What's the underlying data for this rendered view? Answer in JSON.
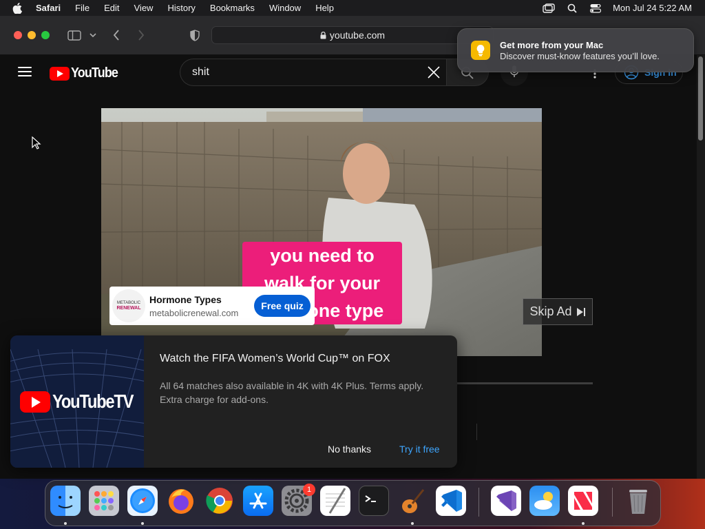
{
  "menubar": {
    "app": "Safari",
    "items": [
      "File",
      "Edit",
      "View",
      "History",
      "Bookmarks",
      "Window",
      "Help"
    ],
    "clock": "Mon Jul 24  5:22 AM"
  },
  "browser": {
    "url": "youtube.com"
  },
  "notification": {
    "title": "Get more from your Mac",
    "body": "Discover must-know features you’ll love."
  },
  "youtube": {
    "logo_text": "YouTube",
    "search_value": "shit",
    "signin_label": "Sign in"
  },
  "video": {
    "caption_lines": [
      "you need to",
      "walk for your",
      "hormone type"
    ],
    "ad": {
      "logo_line1": "METABOLIC",
      "logo_line2": "RENEWAL",
      "title": "Hormone Types",
      "url": "metabolicrenewal.com",
      "cta": "Free quiz"
    },
    "skip_label": "Skip Ad"
  },
  "promo": {
    "logo_text": "YouTubeTV",
    "title": "Watch the FIFA Women’s World Cup™ on FOX",
    "body": "All 64 matches also available in 4K with 4K Plus. Terms apply. Extra charge for add-ons.",
    "no_thanks": "No thanks",
    "try_it": "Try it free"
  },
  "dock": {
    "settings_badge": "1",
    "apps": [
      "finder-icon",
      "launchpad-icon",
      "safari-icon",
      "firefox-icon",
      "chrome-icon",
      "app-store-icon",
      "system-settings-icon",
      "textedit-icon",
      "terminal-icon",
      "garageband-icon",
      "vscode-icon",
      "visual-studio-icon",
      "weather-icon",
      "news-icon",
      "trash-icon"
    ]
  }
}
